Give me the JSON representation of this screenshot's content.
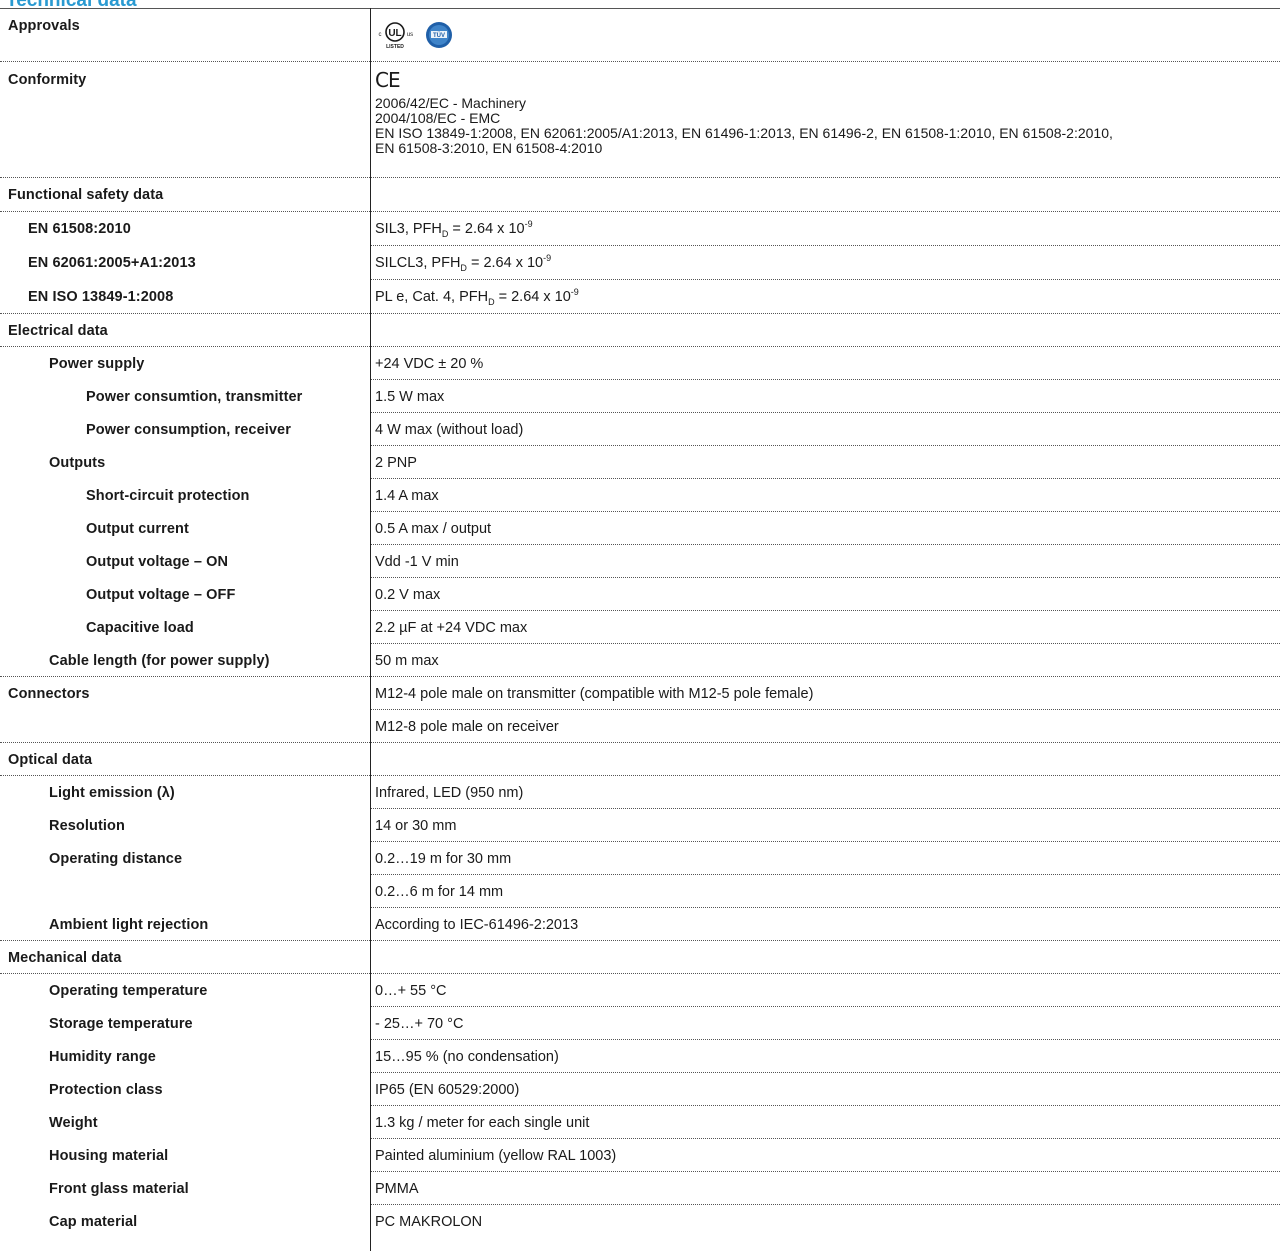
{
  "title": "Technical data",
  "approvals": {
    "label": "Approvals",
    "ul_small_left": "c",
    "ul_text": "UL",
    "ul_small_right": "us",
    "ul_listed": "LISTED",
    "tuv_text": "TÜV"
  },
  "conformity": {
    "label": "Conformity",
    "ce_mark": "CE",
    "lines": [
      "2006/42/EC - Machinery",
      "2004/108/EC - EMC",
      "EN ISO 13849-1:2008, EN 62061:2005/A1:2013, EN 61496-1:2013, EN 61496-2, EN 61508-1:2010, EN 61508-2:2010,",
      "EN 61508-3:2010, EN 61508-4:2010"
    ]
  },
  "functional_safety": {
    "label": "Functional safety data",
    "rows": [
      {
        "label": "EN 61508:2010",
        "prefix": "SIL3, PFH",
        "sub": "D",
        "mid": " = 2.64 x 10",
        "sup": "-9"
      },
      {
        "label": "EN 62061:2005+A1:2013",
        "prefix": "SILCL3, PFH",
        "sub": "D",
        "mid": " = 2.64 x 10",
        "sup": "-9"
      },
      {
        "label": "EN ISO 13849-1:2008",
        "prefix": "PL e, Cat. 4, PFH",
        "sub": "D",
        "mid": " = 2.64 x 10",
        "sup": "-9"
      }
    ]
  },
  "electrical": {
    "label": "Electrical data",
    "power_supply": {
      "label": "Power supply",
      "value": "+24 VDC ± 20 %"
    },
    "power_tx": {
      "label": "Power consumtion, transmitter",
      "value": "1.5 W max"
    },
    "power_rx": {
      "label": "Power consumption, receiver",
      "value": "4 W max (without load)"
    },
    "outputs": {
      "label": "Outputs",
      "value": "2 PNP"
    },
    "short_circuit": {
      "label": "Short-circuit protection",
      "value": "1.4 A max"
    },
    "output_current": {
      "label": "Output current",
      "value": "0.5 A max / output"
    },
    "voltage_on": {
      "label": "Output voltage – ON",
      "value": "Vdd -1 V min"
    },
    "voltage_off": {
      "label": "Output voltage – OFF",
      "value": "0.2 V max"
    },
    "capacitive": {
      "label": "Capacitive load",
      "value": "2.2 µF at +24 VDC max"
    },
    "cable_length": {
      "label": "Cable length (for power supply)",
      "value": "50 m max"
    }
  },
  "connectors": {
    "label": "Connectors",
    "values": [
      "M12-4 pole male on transmitter (compatible with M12-5 pole female)",
      "M12-8 pole male on receiver"
    ]
  },
  "optical": {
    "label": "Optical data",
    "light_emission": {
      "label": "Light emission (λ)",
      "value": "Infrared, LED (950 nm)"
    },
    "resolution": {
      "label": "Resolution",
      "value": "14 or 30 mm"
    },
    "operating_distance": {
      "label": "Operating distance",
      "values": [
        "0.2…19 m for 30 mm",
        "0.2…6 m for 14 mm"
      ]
    },
    "ambient": {
      "label": "Ambient light rejection",
      "value": "According to IEC-61496-2:2013"
    }
  },
  "mechanical": {
    "label": "Mechanical data",
    "rows": [
      {
        "label": "Operating temperature",
        "value": "0…+ 55 °C"
      },
      {
        "label": "Storage temperature",
        "value": "- 25…+ 70 °C"
      },
      {
        "label": "Humidity range",
        "value": "15…95 % (no condensation)"
      },
      {
        "label": "Protection class",
        "value": "IP65 (EN 60529:2000)"
      },
      {
        "label": "Weight",
        "value": "1.3 kg / meter for each single unit"
      },
      {
        "label": "Housing material",
        "value": "Painted aluminium (yellow RAL 1003)"
      },
      {
        "label": "Front glass material",
        "value": "PMMA"
      },
      {
        "label": "Cap material",
        "value": "PC MAKROLON"
      }
    ]
  },
  "colors": {
    "title": "#2a9ad1",
    "tuv_blue": "#1f5fa8",
    "text": "#1a1a1a"
  }
}
